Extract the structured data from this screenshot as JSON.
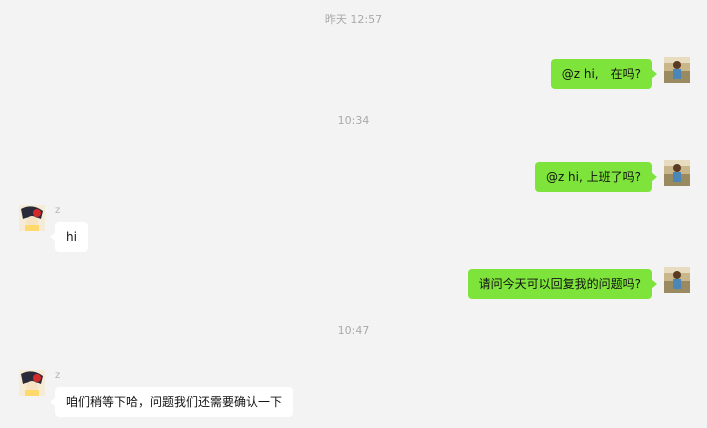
{
  "timestamps": [
    "昨天 12:57",
    "10:34",
    "10:47"
  ],
  "messages": [
    {
      "from": "me",
      "text": "@z hi,　在吗?"
    },
    {
      "from": "me",
      "text": "@z hi, 上班了吗?"
    },
    {
      "from": "them",
      "sender": "z",
      "text": "hi"
    },
    {
      "from": "me",
      "text": "请问今天可以回复我的问题吗?"
    },
    {
      "from": "them",
      "sender": "z",
      "text": "咱们稍等下哈，问题我们还需要确认一下"
    }
  ],
  "colors": {
    "my_bubble": "#7ee43c",
    "their_bubble": "#ffffff",
    "background": "#f3f3f3",
    "timestamp": "#a9a9a9"
  },
  "icons": {
    "my_avatar": "user-photo-avatar",
    "their_avatar": "cartoon-avatar"
  }
}
